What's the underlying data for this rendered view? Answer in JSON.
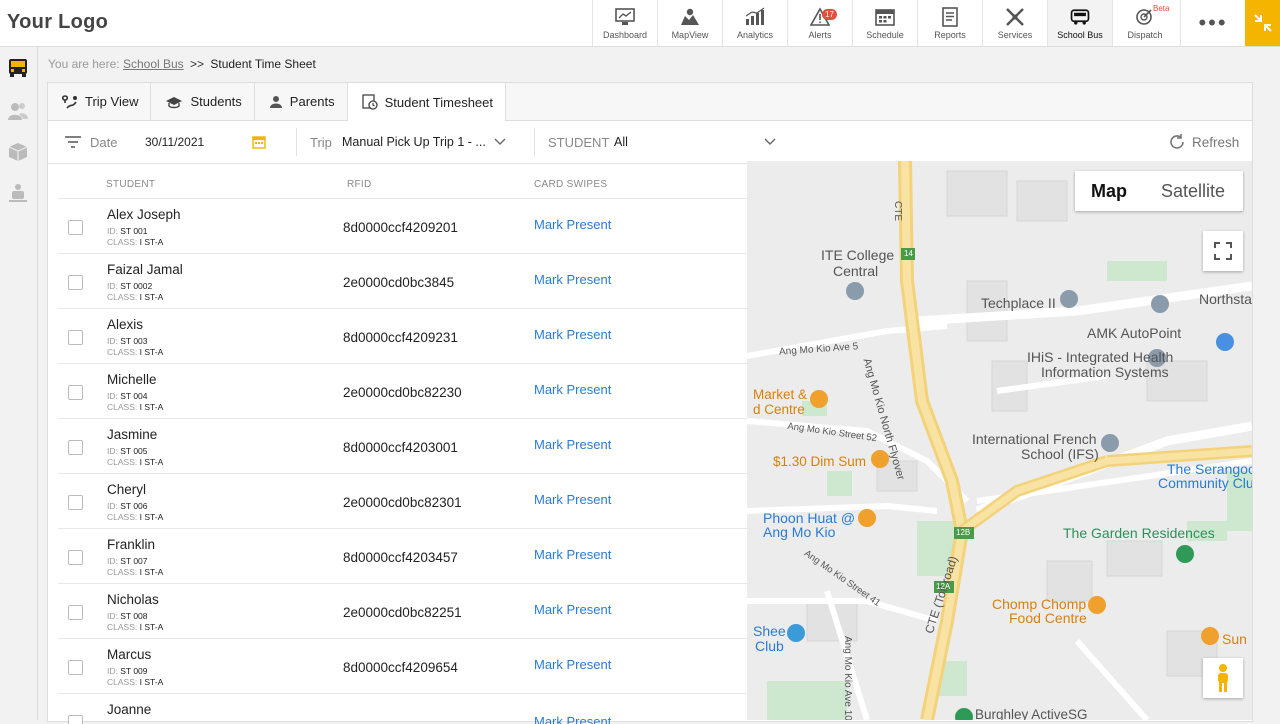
{
  "brand": {
    "logo_text": "Your Logo",
    "accent": "#f5b400"
  },
  "nav": {
    "items": [
      {
        "label": "Dashboard",
        "icon": "dashboard-icon"
      },
      {
        "label": "MapView",
        "icon": "mapview-icon"
      },
      {
        "label": "Analytics",
        "icon": "analytics-icon"
      },
      {
        "label": "Alerts",
        "icon": "alerts-icon",
        "badge": "17"
      },
      {
        "label": "Schedule",
        "icon": "schedule-icon"
      },
      {
        "label": "Reports",
        "icon": "reports-icon"
      },
      {
        "label": "Services",
        "icon": "services-icon"
      },
      {
        "label": "School Bus",
        "icon": "school-bus-icon",
        "active": true
      },
      {
        "label": "Dispatch",
        "icon": "dispatch-icon",
        "tag": "Beta"
      }
    ],
    "more_label": "•••"
  },
  "breadcrumb": {
    "prefix": "You are here:",
    "link": "School Bus",
    "separator": ">>",
    "current": "Student Time Sheet"
  },
  "tabs": [
    {
      "label": "Trip View",
      "icon": "trip-view-icon"
    },
    {
      "label": "Students",
      "icon": "students-icon"
    },
    {
      "label": "Parents",
      "icon": "parents-icon"
    },
    {
      "label": "Student Timesheet",
      "icon": "timesheet-icon",
      "active": true
    }
  ],
  "filters": {
    "date_label": "Date",
    "date_value": "30/11/2021",
    "trip_label": "Trip",
    "trip_value": "Manual Pick Up Trip 1 - ...",
    "student_label": "STUDENT",
    "student_value": "All",
    "refresh_label": "Refresh"
  },
  "table": {
    "columns": [
      "STUDENT",
      "RFID",
      "CARD SWIPES"
    ],
    "id_prefix": "ID:",
    "class_prefix": "CLASS:",
    "rows": [
      {
        "name": "Alex Joseph",
        "id": "ST 001",
        "class": "I ST-A",
        "rfid": "8d0000ccf4209201",
        "action": "Mark Present"
      },
      {
        "name": "Faizal Jamal",
        "id": "ST 0002",
        "class": "I ST-A",
        "rfid": "2e0000cd0bc3845",
        "action": "Mark Present"
      },
      {
        "name": "Alexis",
        "id": "ST 003",
        "class": "I ST-A",
        "rfid": "8d0000ccf4209231",
        "action": "Mark Present"
      },
      {
        "name": "Michelle",
        "id": "ST 004",
        "class": "I ST-A",
        "rfid": "2e0000cd0bc82230",
        "action": "Mark Present"
      },
      {
        "name": "Jasmine",
        "id": "ST 005",
        "class": "I ST-A",
        "rfid": "8d0000ccf4203001",
        "action": "Mark Present"
      },
      {
        "name": "Cheryl",
        "id": "ST 006",
        "class": "I ST-A",
        "rfid": "2e0000cd0bc82301",
        "action": "Mark Present"
      },
      {
        "name": "Franklin",
        "id": "ST 007",
        "class": "I ST-A",
        "rfid": "8d0000ccf4203457",
        "action": "Mark Present"
      },
      {
        "name": "Nicholas",
        "id": "ST 008",
        "class": "I ST-A",
        "rfid": "2e0000cd0bc82251",
        "action": "Mark Present"
      },
      {
        "name": "Marcus",
        "id": "ST 009",
        "class": "I ST-A",
        "rfid": "8d0000ccf4209654",
        "action": "Mark Present"
      },
      {
        "name": "Joanne",
        "id": "",
        "class": "",
        "rfid": "",
        "action": "Mark Present"
      }
    ]
  },
  "map": {
    "type_buttons": [
      "Map",
      "Satellite"
    ],
    "active_type": "Map",
    "labels": [
      {
        "text": "ITE College",
        "kind": "plain"
      },
      {
        "text": "Central",
        "kind": "plain"
      },
      {
        "text": "Techplace II",
        "kind": "plain"
      },
      {
        "text": "Northsta",
        "kind": "plain"
      },
      {
        "text": "AMK AutoPoint",
        "kind": "plain"
      },
      {
        "text": "IHiS - Integrated Health",
        "kind": "plain"
      },
      {
        "text": "Information Systems",
        "kind": "plain"
      },
      {
        "text": "Ang Mo Kio Ave 5",
        "kind": "plain"
      },
      {
        "text": "Ang Mo Kio North Flyover",
        "kind": "plain"
      },
      {
        "text": "Market &",
        "kind": "orange"
      },
      {
        "text": "d Centre",
        "kind": "orange"
      },
      {
        "text": "Ang Mo Kio Street 52",
        "kind": "plain"
      },
      {
        "text": "$1.30 Dim Sum",
        "kind": "orange"
      },
      {
        "text": "International French",
        "kind": "plain"
      },
      {
        "text": "School (IFS)",
        "kind": "plain"
      },
      {
        "text": "The Serangoo",
        "kind": "blue"
      },
      {
        "text": "Community Clu",
        "kind": "blue"
      },
      {
        "text": "Phoon Huat @",
        "kind": "blue"
      },
      {
        "text": "Ang Mo Kio",
        "kind": "blue"
      },
      {
        "text": "The Garden Residences",
        "kind": "green"
      },
      {
        "text": "Chomp Chomp",
        "kind": "orange"
      },
      {
        "text": "Food Centre",
        "kind": "orange"
      },
      {
        "text": "Ang Mo Kio Street 41",
        "kind": "plain"
      },
      {
        "text": "Ang Mo Kio Ave 10",
        "kind": "plain"
      },
      {
        "text": "CTE (Toll road)",
        "kind": "plain"
      },
      {
        "text": "Shee",
        "kind": "blue"
      },
      {
        "text": "Club",
        "kind": "blue"
      },
      {
        "text": "Sun",
        "kind": "orange"
      },
      {
        "text": "Burghley ActiveSG",
        "kind": "plain"
      },
      {
        "text": "CTE",
        "kind": "plain"
      },
      {
        "text": "14",
        "kind": "plain"
      },
      {
        "text": "12B",
        "kind": "plain"
      },
      {
        "text": "12A",
        "kind": "plain"
      }
    ]
  }
}
